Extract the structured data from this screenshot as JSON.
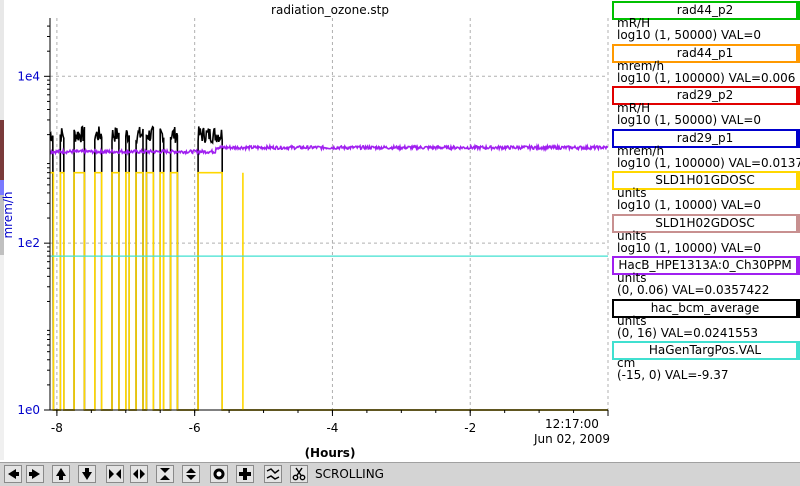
{
  "plot": {
    "title": "radiation_ozone.stp",
    "ylabel": "mrem/h",
    "xlabel": "(Hours)",
    "time_label": "12:17:00",
    "date_label": "Jun 02, 2009"
  },
  "chart_data": {
    "type": "line",
    "title": "radiation_ozone.stp",
    "xlabel": "(Hours)",
    "ylabel": "mrem/h",
    "yscale": "log",
    "xlim": [
      -8.1,
      0.0
    ],
    "ylim": [
      1,
      50000
    ],
    "yticks": [
      {
        "value": 1,
        "label": "1e0"
      },
      {
        "value": 100,
        "label": "1e2"
      },
      {
        "value": 10000,
        "label": "1e4"
      }
    ],
    "xticks": [
      {
        "value": -8,
        "label": "-8"
      },
      {
        "value": -6,
        "label": "-6"
      },
      {
        "value": -4,
        "label": "-4"
      },
      {
        "value": -2,
        "label": "-2"
      },
      {
        "value": 0,
        "label": "12:17:00"
      }
    ],
    "grid": true,
    "legend_placement": "right",
    "series": [
      {
        "name": "hac_bcm_average",
        "color": "#000000",
        "style": "noisy-toggling",
        "segments": [
          {
            "x_start": -8.1,
            "x_end": -6.35,
            "level": 2000,
            "noise": 0.12
          },
          {
            "x_start": -6.25,
            "x_end": -5.95,
            "level": 2000,
            "noise": 0.12
          },
          {
            "x_start": -5.6,
            "x_end": -5.3,
            "level": 2600,
            "noise": 0.1
          }
        ],
        "low_value": 1,
        "drops": [
          -8.05,
          -7.95,
          -7.9,
          -7.75,
          -7.6,
          -7.45,
          -7.35,
          -7.2,
          -7.1,
          -7.0,
          -6.95,
          -6.85,
          -6.75,
          -6.7,
          -6.6,
          -6.5,
          -6.45,
          -6.35,
          -6.25,
          -5.95,
          -5.6,
          -5.3
        ],
        "after_x": -5.2,
        "after_value": 1
      },
      {
        "name": "SLD1H01GDOSC",
        "color": "#ffd700",
        "style": "toggling",
        "level": 700,
        "low_value": 1,
        "end_x": -5.3
      },
      {
        "name": "HacB_HPE1313A:0_Ch30PPM",
        "color": "#a020f0",
        "style": "noisy",
        "x_start": -8.1,
        "x_end": 0.0,
        "level": 1250,
        "noise": 0.02,
        "level_changes": [
          {
            "x": -5.7,
            "level": 1400
          }
        ]
      },
      {
        "name": "HaGenTargPos.VAL",
        "color": "#40e0d0",
        "style": "constant",
        "x_start": -8.1,
        "x_end": 0.0,
        "level": 70
      }
    ]
  },
  "legend": {
    "entries": [
      {
        "name": "rad44_p2",
        "unit": "mR/H",
        "range": "log10 (1, 50000) VAL=0",
        "color": "#00c000"
      },
      {
        "name": "rad44_p1",
        "unit": "mrem/h",
        "range": "log10 (1, 100000) VAL=0.006",
        "color": "#ff9900"
      },
      {
        "name": "rad29_p2",
        "unit": "mR/H",
        "range": "log10 (1, 50000) VAL=0",
        "color": "#e00000"
      },
      {
        "name": "rad29_p1",
        "unit": "mrem/h",
        "range": "log10 (1, 100000) VAL=0.0137",
        "color": "#0000cc"
      },
      {
        "name": "SLD1H01GDOSC",
        "unit": "units",
        "range": "log10 (1, 10000) VAL=0",
        "color": "#ffd700"
      },
      {
        "name": "SLD1H02GDOSC",
        "unit": "units",
        "range": "log10 (1, 10000) VAL=0",
        "color": "#c89090"
      },
      {
        "name": "HacB_HPE1313A:0_Ch30PPM",
        "unit": "units",
        "range": "(0, 0.06) VAL=0.0357422",
        "color": "#a020f0"
      },
      {
        "name": "hac_bcm_average",
        "unit": "units",
        "range": "(0, 16) VAL=0.0241553",
        "color": "#000000"
      },
      {
        "name": "HaGenTargPos.VAL",
        "unit": "cm",
        "range": "(-15, 0) VAL=-9.37",
        "color": "#40e0d0"
      }
    ]
  },
  "toolbar": {
    "status": "SCROLLING",
    "buttons": [
      {
        "icon": "arrow-left-icon",
        "name": "scroll-left-button"
      },
      {
        "icon": "arrow-right-icon",
        "name": "scroll-right-button"
      },
      {
        "icon": "arrow-up-icon",
        "name": "scroll-up-button"
      },
      {
        "icon": "arrow-down-icon",
        "name": "scroll-down-button"
      },
      {
        "icon": "zoom-in-horizontal-icon",
        "name": "zoom-in-x-button"
      },
      {
        "icon": "zoom-out-horizontal-icon",
        "name": "zoom-out-x-button"
      },
      {
        "icon": "zoom-in-vertical-icon",
        "name": "zoom-in-y-button"
      },
      {
        "icon": "zoom-out-vertical-icon",
        "name": "zoom-out-y-button"
      },
      {
        "icon": "record-icon",
        "name": "record-button"
      },
      {
        "icon": "plus-icon",
        "name": "add-button"
      },
      {
        "icon": "autoscale-icon",
        "name": "autoscale-button"
      },
      {
        "icon": "scissors-icon",
        "name": "cut-button"
      }
    ]
  }
}
